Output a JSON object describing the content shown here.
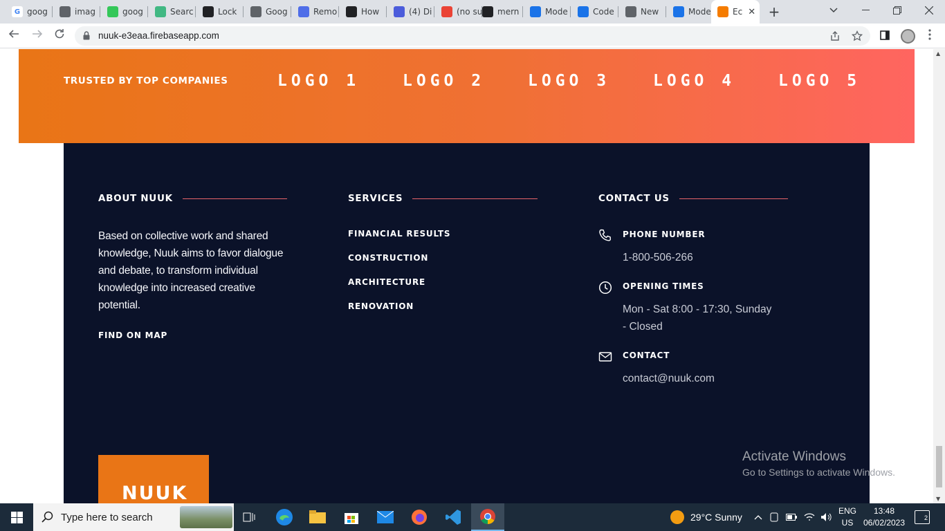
{
  "browser": {
    "tabs": [
      {
        "title": "goog",
        "favicon": "google-icon",
        "color": "#ffffff"
      },
      {
        "title": "imag",
        "favicon": "globe-icon",
        "color": "#5f6368"
      },
      {
        "title": "goog",
        "favicon": "bolt-icon",
        "color": "#34c759"
      },
      {
        "title": "Searc",
        "favicon": "vue-icon",
        "color": "#41b883"
      },
      {
        "title": "Lock",
        "favicon": "st-icon",
        "color": "#202124"
      },
      {
        "title": "Goog",
        "favicon": "globe-icon",
        "color": "#5f6368"
      },
      {
        "title": "Remo",
        "favicon": "triangle-icon",
        "color": "#4f6ee8"
      },
      {
        "title": "How",
        "favicon": "terminal-icon",
        "color": "#202124"
      },
      {
        "title": "(4) Di",
        "favicon": "dm-icon",
        "color": "#4b5cdb"
      },
      {
        "title": "(no su",
        "favicon": "gmail-icon",
        "color": "#ea4335"
      },
      {
        "title": "mern",
        "favicon": "github-icon",
        "color": "#202124"
      },
      {
        "title": "Mode",
        "favicon": "e-icon",
        "color": "#1a73e8"
      },
      {
        "title": "Code",
        "favicon": "c-icon",
        "color": "#1a73e8"
      },
      {
        "title": "New",
        "favicon": "chrome-icon",
        "color": "#5f6368"
      },
      {
        "title": "Mode",
        "favicon": "e-icon",
        "color": "#1a73e8"
      },
      {
        "title": "Ec",
        "favicon": "orange-square-icon",
        "color": "#f57c00",
        "active": true
      }
    ],
    "url": "nuuk-e3eaa.firebaseapp.com"
  },
  "banner": {
    "trusted_label": "TRUSTED BY TOP COMPANIES",
    "logos": [
      "LOGO 1",
      "LOGO 2",
      "LOGO 3",
      "LOGO 4",
      "LOGO 5"
    ]
  },
  "footer": {
    "about": {
      "heading": "ABOUT NUUK",
      "text": "Based on collective work and shared knowledge, Nuuk aims to favor dialogue and debate, to transform individual knowledge into increased creative potential.",
      "map_link": "FIND ON MAP"
    },
    "services": {
      "heading": "SERVICES",
      "items": [
        "FINANCIAL RESULTS",
        "CONSTRUCTION",
        "ARCHITECTURE",
        "RENOVATION"
      ]
    },
    "contact": {
      "heading": "CONTACT US",
      "phone_label": "PHONE NUMBER",
      "phone_value": "1-800-506-266",
      "hours_label": "OPENING TIMES",
      "hours_value": "Mon - Sat 8:00 - 17:30, Sunday - Closed",
      "email_label": "CONTACT",
      "email_value": "contact@nuuk.com"
    },
    "brand": "NUUK"
  },
  "watermark": {
    "title": "Activate Windows",
    "subtitle": "Go to Settings to activate Windows."
  },
  "taskbar": {
    "search_placeholder": "Type here to search",
    "weather": "29°C  Sunny",
    "lang_top": "ENG",
    "lang_bottom": "US",
    "time": "13:48",
    "date": "06/02/2023",
    "notifications": "2"
  },
  "colors": {
    "accent": "#e97516",
    "footer_bg": "#0b1229",
    "divider": "#e8646a"
  }
}
